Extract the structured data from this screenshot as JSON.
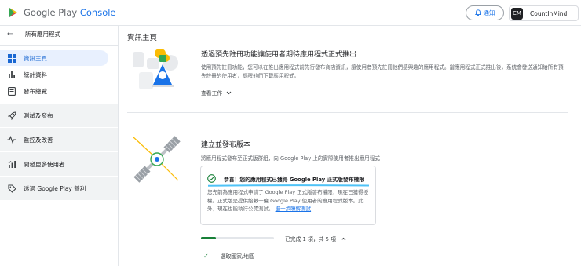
{
  "topbar": {
    "brand": "Google Play",
    "product": "Console",
    "notify_label": "通知",
    "account_name": "CountInMind",
    "account_initials": "CM"
  },
  "sidebar": {
    "back_label": "所有應用程式",
    "items": [
      {
        "label": "資訊主頁",
        "icon": "dashboard-icon",
        "active": true
      },
      {
        "label": "統計資料",
        "icon": "bar-chart-icon",
        "active": false
      },
      {
        "label": "發布總覽",
        "icon": "overview-icon",
        "active": false
      }
    ],
    "sections": [
      {
        "label": "測試及發布",
        "icon": "rocket-icon"
      },
      {
        "label": "監控及改善",
        "icon": "vitals-icon"
      },
      {
        "label": "開發更多使用者",
        "icon": "grow-users-icon"
      },
      {
        "label": "透過 Google Play 營利",
        "icon": "tag-icon"
      }
    ]
  },
  "main": {
    "title": "資訊主頁",
    "card1": {
      "title": "透過預先註冊功能讓使用者期待應用程式正式推出",
      "description": "使用預先註冊功能，您可以在推出應用程式前先行發布商店資訊，讓使用者預先註冊他們感興趣的應用程式。當應用程式正式推出後，系統會發送通知給所有預先註冊的使用者，提醒他們下載應用程式。",
      "link_label": "查看工作"
    },
    "card2": {
      "title": "建立並發布版本",
      "description": "將應用程式發布至正式版群組，向 Google Play 上的實際使用者推出應用程式",
      "notice_title": "恭喜！您的應用程式已獲得 Google Play 正式版發布權限",
      "notice_body": "您先前為應用程式申請了 Google Play 正式版發布權限，現在已獲得授權。正式版是提供給數十億 Google Play 使用者的應用程式版本。此外，現在也能執行公開測試。",
      "notice_link": "進一步瞭解測試",
      "progress_text": "已完成 1 項，共 5 項",
      "progress_fraction": 0.2,
      "step1": "選取國家/地區"
    }
  },
  "colors": {
    "accent": "#1a73e8",
    "active_bg": "#e8f0fe",
    "success": "#188038"
  }
}
